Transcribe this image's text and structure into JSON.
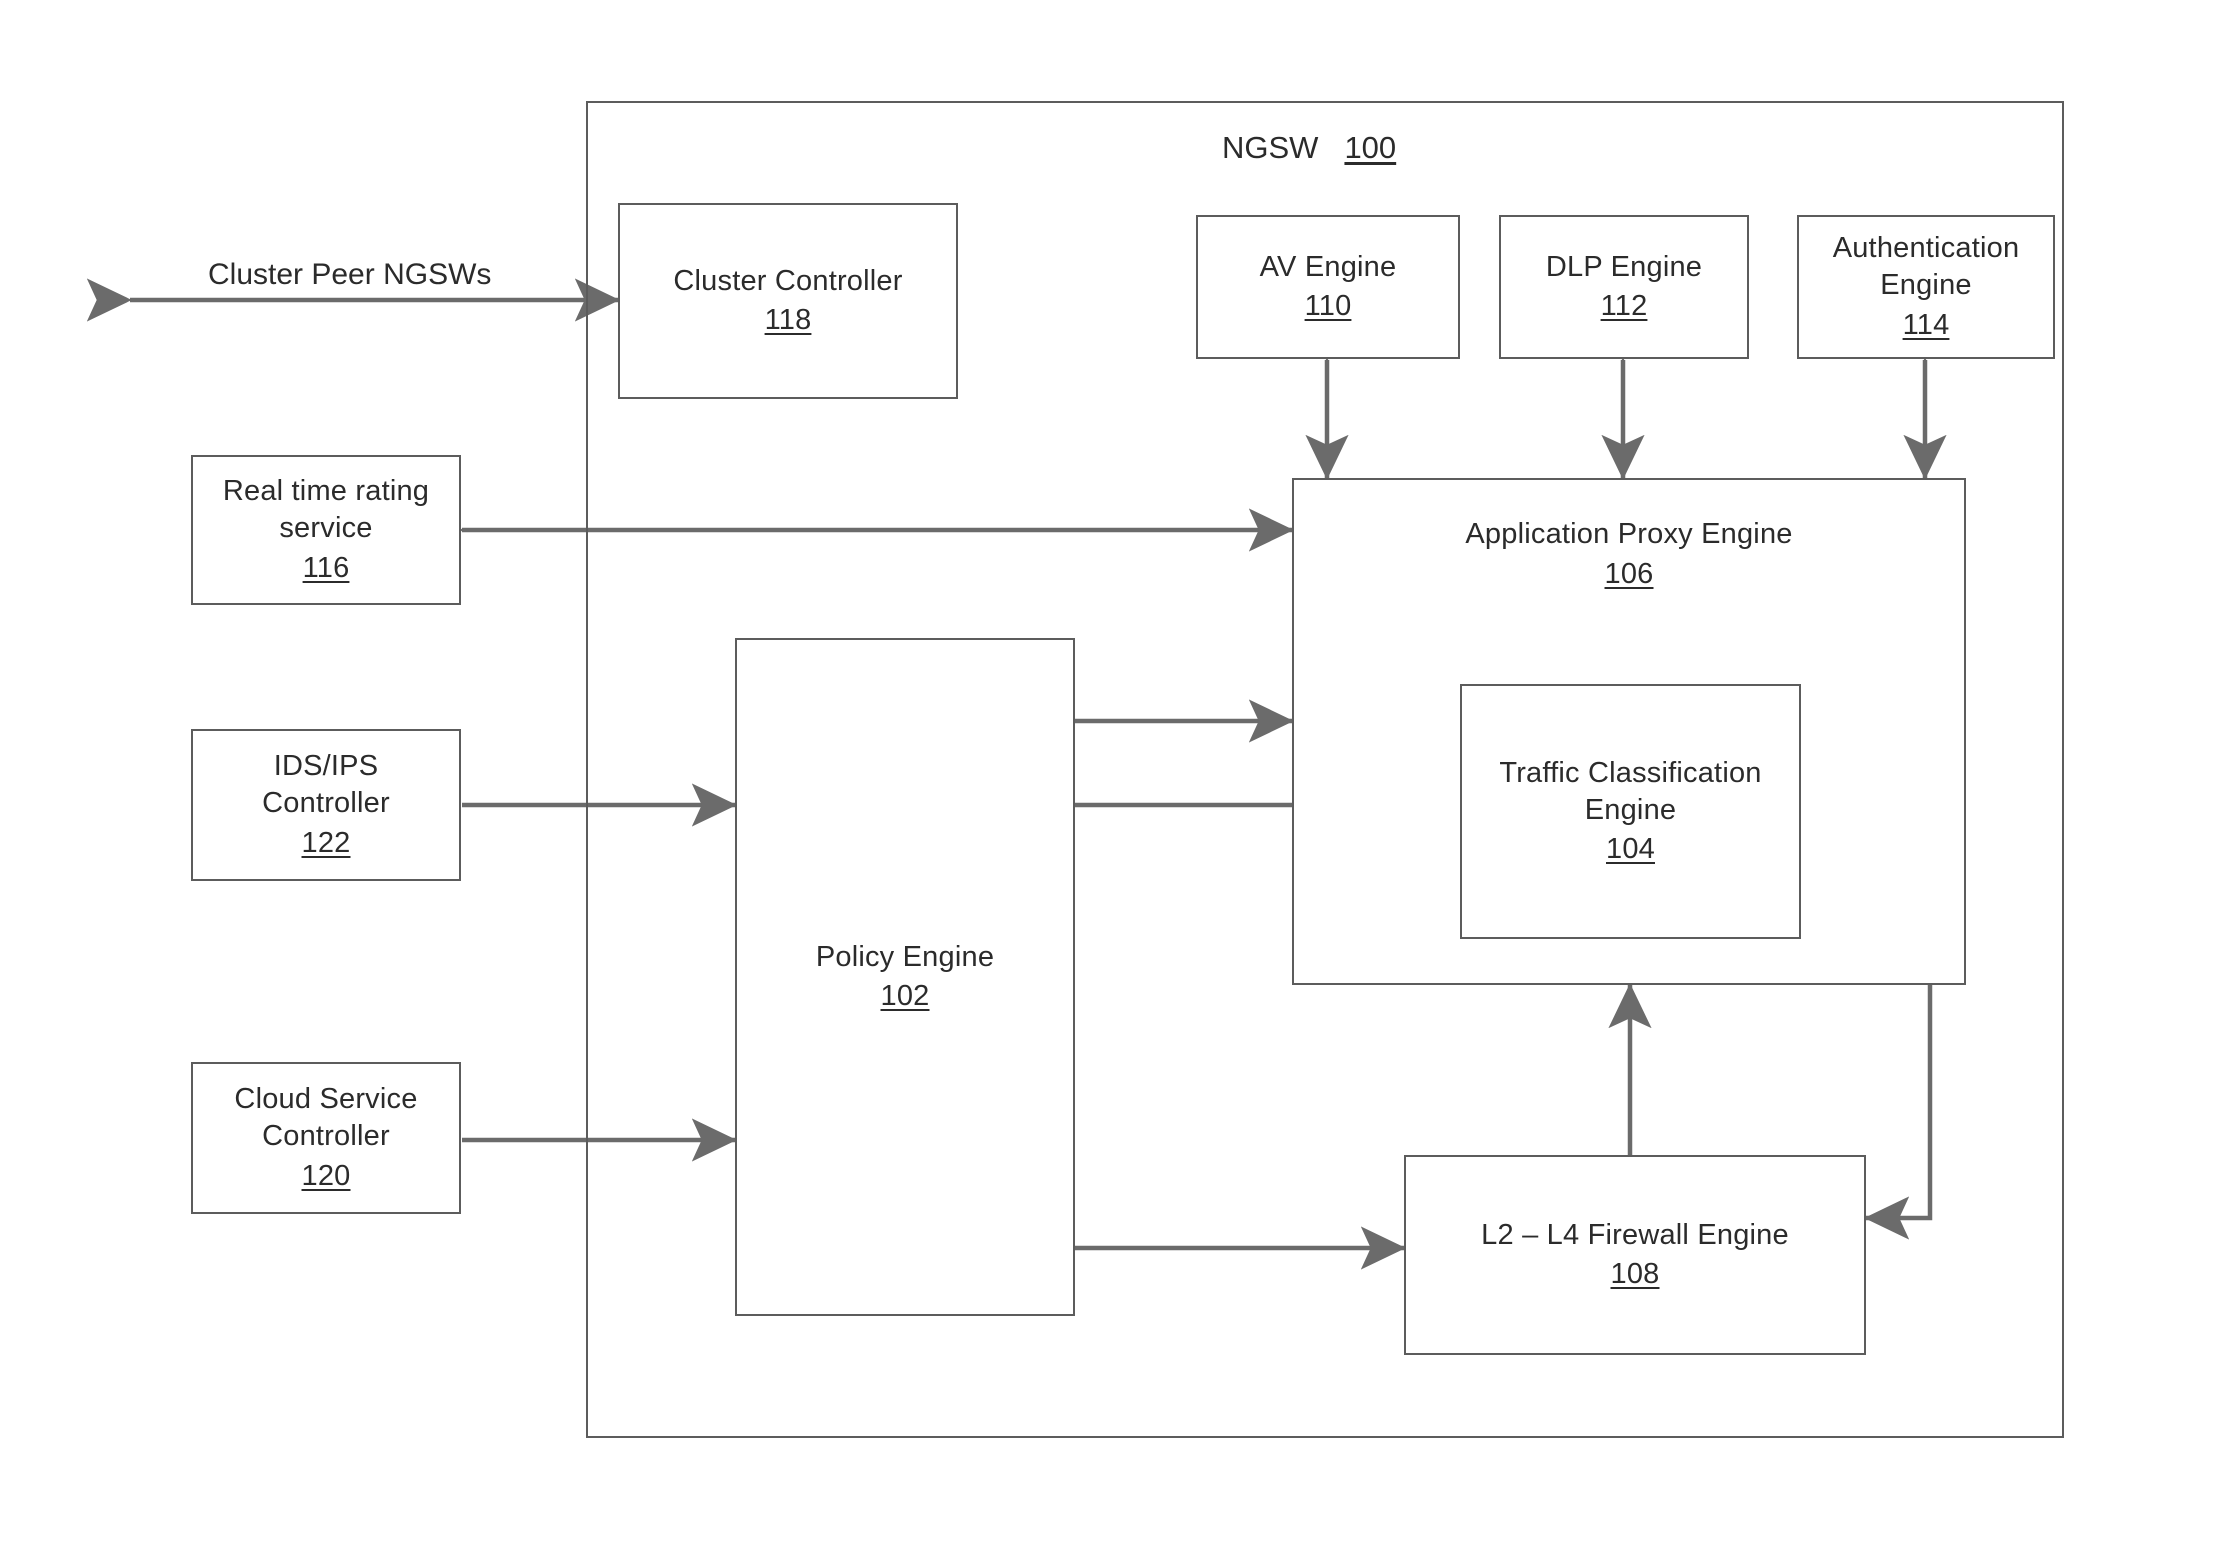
{
  "figure": {
    "title": "NGSW",
    "title_ref": "100"
  },
  "external_labels": [
    {
      "text": "Cluster Peer NGSWs"
    }
  ],
  "blocks": {
    "cluster_controller": {
      "label": "Cluster Controller",
      "ref": "118"
    },
    "av_engine": {
      "label": "AV Engine",
      "ref": "110"
    },
    "dlp_engine": {
      "label": "DLP Engine",
      "ref": "112"
    },
    "auth_engine": {
      "label": "Authentication\nEngine",
      "ref": "114"
    },
    "rating_service": {
      "label": "Real time rating\nservice",
      "ref": "116"
    },
    "ids_ips": {
      "label": "IDS/IPS\nController",
      "ref": "122"
    },
    "cloud_service": {
      "label": "Cloud Service\nController",
      "ref": "120"
    },
    "policy_engine": {
      "label": "Policy Engine",
      "ref": "102"
    },
    "app_proxy": {
      "label": "Application Proxy Engine",
      "ref": "106"
    },
    "traffic_class": {
      "label": "Traffic Classification\nEngine",
      "ref": "104"
    },
    "firewall": {
      "label": "L2 – L4 Firewall Engine",
      "ref": "108"
    }
  },
  "colors": {
    "stroke": "#5c5c5c",
    "arrow": "#6b6b6b",
    "text": "#2b2b2b",
    "background": "#ffffff"
  },
  "connections": [
    {
      "name": "cluster-peers-to-cluster-controller",
      "style": "double-arrow",
      "orientation": "horizontal"
    },
    {
      "name": "av-engine-to-app-proxy",
      "style": "double-arrow",
      "orientation": "vertical"
    },
    {
      "name": "dlp-engine-to-app-proxy",
      "style": "double-arrow",
      "orientation": "vertical"
    },
    {
      "name": "auth-engine-to-app-proxy",
      "style": "double-arrow",
      "orientation": "vertical"
    },
    {
      "name": "rating-service-to-app-proxy",
      "style": "double-arrow",
      "orientation": "horizontal"
    },
    {
      "name": "ids-ips-to-policy-engine",
      "style": "single-arrow",
      "orientation": "horizontal"
    },
    {
      "name": "cloud-service-to-policy-engine",
      "style": "single-arrow",
      "orientation": "horizontal"
    },
    {
      "name": "policy-engine-to-app-proxy",
      "style": "double-arrow",
      "orientation": "horizontal"
    },
    {
      "name": "policy-engine-to-traffic-class",
      "style": "double-arrow",
      "orientation": "horizontal"
    },
    {
      "name": "policy-engine-to-firewall",
      "style": "double-arrow",
      "orientation": "horizontal"
    },
    {
      "name": "firewall-to-app-proxy",
      "style": "single-arrow",
      "orientation": "vertical"
    },
    {
      "name": "app-proxy-to-firewall-return",
      "style": "single-arrow",
      "orientation": "elbow"
    }
  ]
}
